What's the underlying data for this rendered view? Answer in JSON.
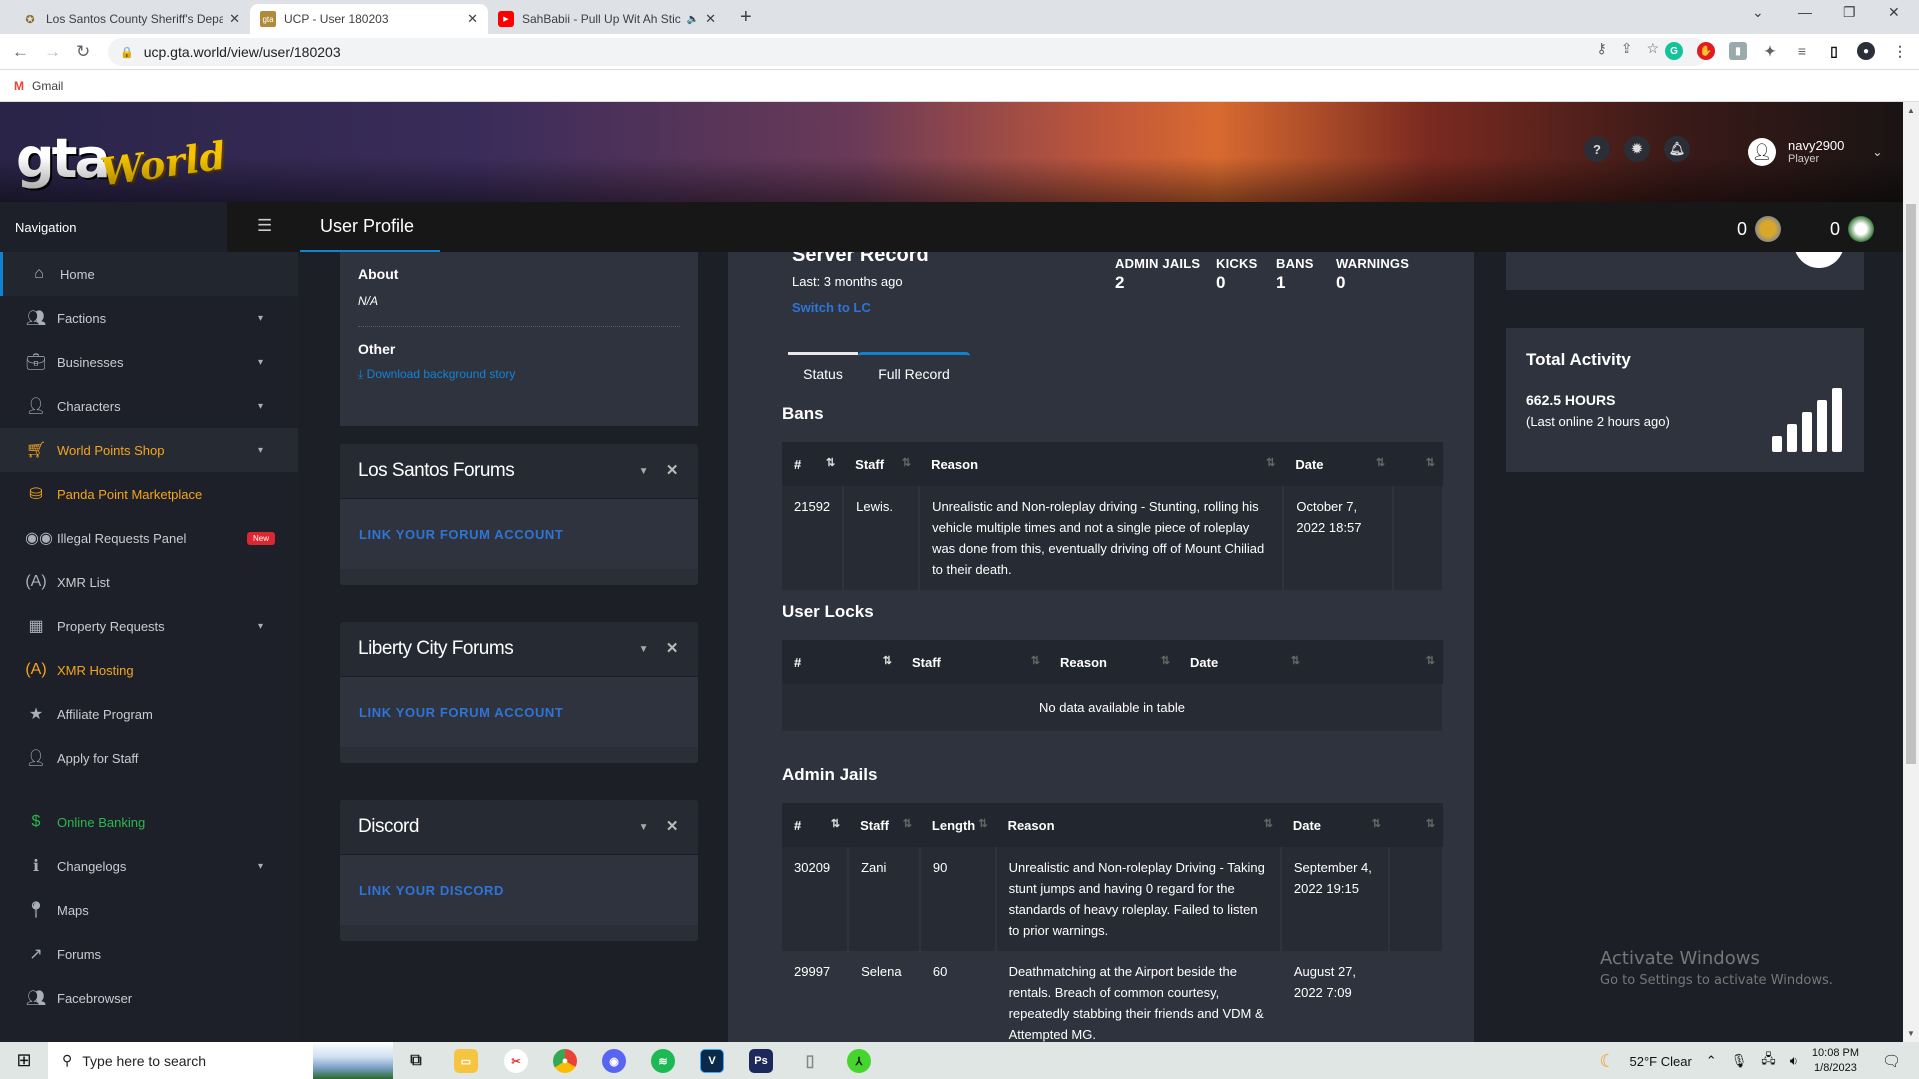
{
  "browser": {
    "tabs": [
      {
        "title": "Los Santos County Sheriff's Depa",
        "icon": "sheriff-star-icon",
        "active": false
      },
      {
        "title": "UCP - User 180203",
        "icon": "gta-world-icon",
        "active": true
      },
      {
        "title": "SahBabii - Pull Up Wit Ah Stic",
        "icon": "youtube-icon",
        "active": false,
        "audio": true
      }
    ],
    "url": "ucp.gta.world/view/user/180203",
    "bookmarks": [
      {
        "label": "Gmail",
        "icon": "gmail-icon"
      }
    ]
  },
  "site": {
    "logo_gta": "gta",
    "logo_world": "World",
    "header_buttons": [
      "help-icon",
      "settings-icon",
      "bell-icon"
    ],
    "user": {
      "name": "navy2900",
      "role": "Player"
    }
  },
  "topbar": {
    "nav_label": "Navigation",
    "page_title": "User Profile",
    "world_points": "0",
    "panda_points": "0"
  },
  "sidebar": {
    "items": [
      {
        "label": "Home",
        "icon": "home-icon",
        "expandable": false,
        "active": true
      },
      {
        "label": "Factions",
        "icon": "users-icon",
        "expandable": true
      },
      {
        "label": "Businesses",
        "icon": "briefcase-icon",
        "expandable": true
      },
      {
        "label": "Characters",
        "icon": "user-icon",
        "expandable": true
      },
      {
        "label": "World Points Shop",
        "icon": "cart-icon",
        "expandable": true,
        "color": "gold"
      },
      {
        "label": "Panda Point Marketplace",
        "icon": "coins-icon",
        "expandable": false,
        "color": "gold"
      },
      {
        "label": "Illegal Requests Panel",
        "icon": "mask-icon",
        "expandable": false,
        "badge": "New"
      },
      {
        "label": "XMR List",
        "icon": "antenna-icon",
        "expandable": false
      },
      {
        "label": "Property Requests",
        "icon": "building-icon",
        "expandable": true
      },
      {
        "label": "XMR Hosting",
        "icon": "antenna-icon",
        "expandable": false,
        "color": "gold"
      },
      {
        "label": "Affiliate Program",
        "icon": "star-icon",
        "expandable": false
      },
      {
        "label": "Apply for Staff",
        "icon": "user-tie-icon",
        "expandable": false
      },
      {
        "label": "Online Banking",
        "icon": "dollar-icon",
        "expandable": false,
        "color": "green"
      },
      {
        "label": "Changelogs",
        "icon": "info-icon",
        "expandable": true
      },
      {
        "label": "Maps",
        "icon": "map-marker-icon",
        "expandable": false
      },
      {
        "label": "Forums",
        "icon": "external-link-icon",
        "expandable": false
      },
      {
        "label": "Facebrowser",
        "icon": "users-icon",
        "expandable": false
      }
    ]
  },
  "about": {
    "heading": "About",
    "value": "N/A",
    "other_heading": "Other",
    "download_link": "Download background story"
  },
  "boxes": [
    {
      "title": "Los Santos Forums",
      "link": "LINK YOUR FORUM ACCOUNT"
    },
    {
      "title": "Liberty City Forums",
      "link": "LINK YOUR FORUM ACCOUNT"
    },
    {
      "title": "Discord",
      "link": "LINK YOUR DISCORD"
    }
  ],
  "server_record": {
    "title": "Server Record",
    "last": "Last: 3 months ago",
    "switch_link": "Switch to LC",
    "stats": [
      {
        "label": "ADMIN JAILS",
        "value": "2"
      },
      {
        "label": "KICKS",
        "value": "0"
      },
      {
        "label": "BANS",
        "value": "1"
      },
      {
        "label": "WARNINGS",
        "value": "0"
      }
    ],
    "tabs": [
      "Status",
      "Full Record"
    ],
    "active_tab": "Full Record",
    "bans": {
      "title": "Bans",
      "columns": [
        "#",
        "Staff",
        "Reason",
        "Date",
        ""
      ],
      "rows": [
        {
          "id": "21592",
          "staff": "Lewis.",
          "reason": "Unrealistic and Non-roleplay driving - Stunting, rolling his vehicle multiple times and not a single piece of roleplay was done from this, eventually driving off of Mount Chiliad to their death.",
          "date": "October 7, 2022 18:57"
        }
      ]
    },
    "user_locks": {
      "title": "User Locks",
      "columns": [
        "#",
        "Staff",
        "Reason",
        "Date",
        ""
      ],
      "empty": "No data available in table"
    },
    "admin_jails": {
      "title": "Admin Jails",
      "columns": [
        "#",
        "Staff",
        "Length",
        "Reason",
        "Date",
        ""
      ],
      "rows": [
        {
          "id": "30209",
          "staff": "Zani",
          "length": "90",
          "reason": "Unrealistic and Non-roleplay Driving - Taking stunt jumps and having 0 regard for the standards of heavy roleplay. Failed to listen to prior warnings.",
          "date": "September 4, 2022 19:15"
        },
        {
          "id": "29997",
          "staff": "Selena",
          "length": "60",
          "reason": "Deathmatching at the Airport beside the rentals. Breach of common courtesy, repeatedly stabbing their friends and VDM & Attempted MG.",
          "date": "August 27, 2022 7:09"
        }
      ]
    }
  },
  "activity": {
    "title": "Total Activity",
    "hours": "662.5 HOURS",
    "last_online": "(Last online 2 hours ago)"
  },
  "watermark": {
    "title": "Activate Windows",
    "subtitle": "Go to Settings to activate Windows."
  },
  "taskbar": {
    "search_placeholder": "Type here to search",
    "weather": "52°F  Clear",
    "time": "10:08 PM",
    "date": "1/8/2023",
    "apps": [
      "task-view-icon",
      "file-explorer-icon",
      "snipping-tool-icon",
      "chrome-icon",
      "discord-icon",
      "spotify-icon",
      "vegas-icon",
      "photoshop-icon",
      "mouse-app-icon",
      "razer-icon"
    ]
  }
}
